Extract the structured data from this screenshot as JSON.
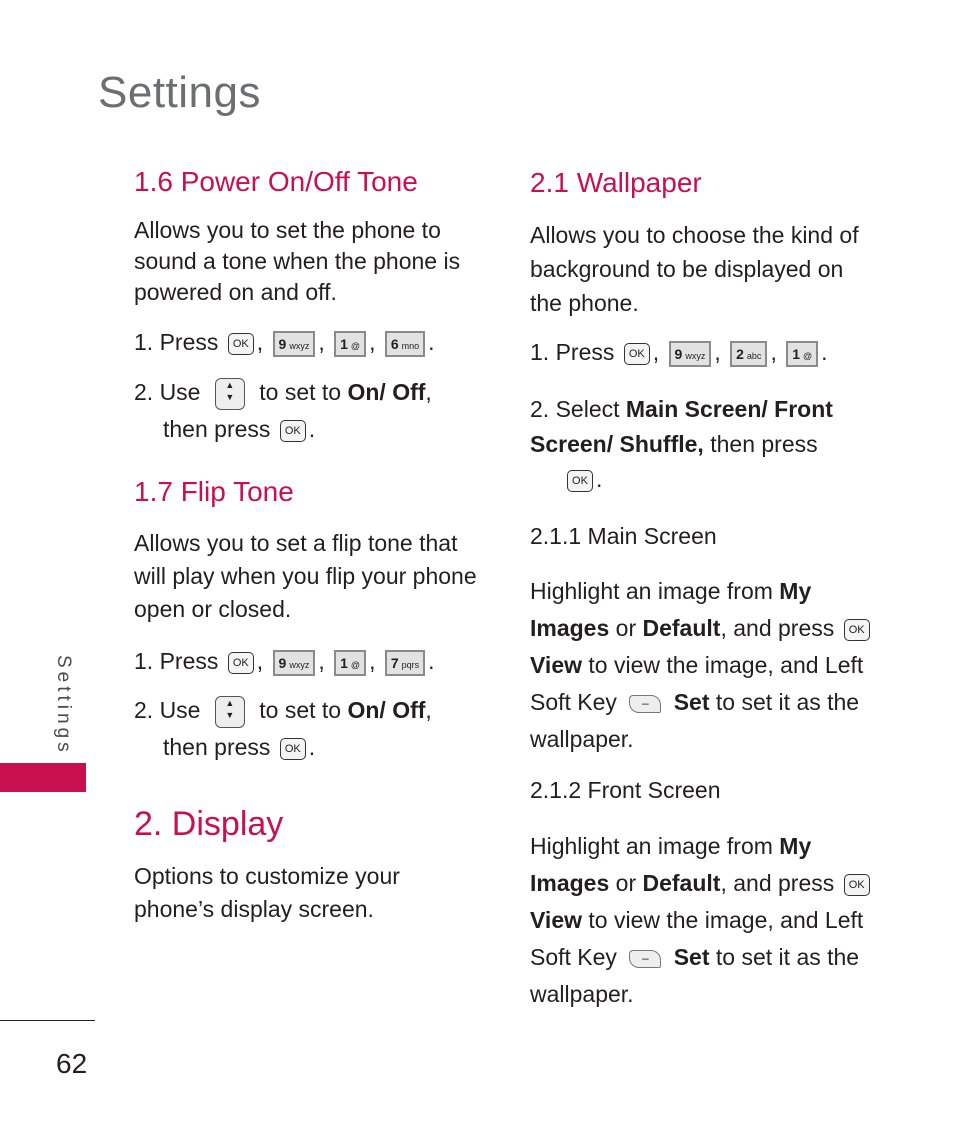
{
  "page_title": "Settings",
  "side_tab": "Settings",
  "page_number": "62",
  "accent_color": "#c8104e",
  "left": {
    "s16": {
      "heading": "1.6 Power On/Off Tone",
      "desc": "Allows you to set the phone to sound a tone when the phone is powered on and off.",
      "step1_prefix": "1. Press",
      "step1_keys": [
        {
          "num": "9",
          "letters": "wxyz"
        },
        {
          "num": "1",
          "letters": "@"
        },
        {
          "num": "6",
          "letters": "mno"
        }
      ],
      "step2_prefix": "2. Use",
      "step2_mid": "to set to",
      "step2_bold": "On/ Off",
      "step2_end": ",",
      "step2_cont": "then press"
    },
    "s17": {
      "heading": "1.7 Flip Tone",
      "desc": "Allows you to set a flip tone that will play when you flip your phone open or closed.",
      "step1_prefix": "1. Press",
      "step1_keys": [
        {
          "num": "9",
          "letters": "wxyz"
        },
        {
          "num": "1",
          "letters": "@"
        },
        {
          "num": "7",
          "letters": "pqrs"
        }
      ],
      "step2_prefix": "2. Use",
      "step2_mid": "to set to",
      "step2_bold": "On/ Off",
      "step2_end": ",",
      "step2_cont": "then press"
    },
    "s2": {
      "heading": "2. Display",
      "desc": "Options to customize your phone’s display screen."
    }
  },
  "right": {
    "s21": {
      "heading": "2.1 Wallpaper",
      "desc": "Allows you to choose the kind of background to be displayed on the phone.",
      "step1_prefix": "1. Press",
      "step1_keys": [
        {
          "num": "9",
          "letters": "wxyz"
        },
        {
          "num": "2",
          "letters": "abc"
        },
        {
          "num": "1",
          "letters": "@"
        }
      ],
      "step2_prefix": "2. Select",
      "step2_bold1": "Main Screen/ Front Screen/ Shuffle,",
      "step2_end": "then press"
    },
    "s211": {
      "heading": "2.1.1 Main Screen",
      "t1": "Highlight an image from",
      "b1": "My Images",
      "t2": "or",
      "b2": "Default",
      "t3": ", and press",
      "b3": "View",
      "t4": "to view the image, and Left Soft Key",
      "b4": "Set",
      "t5": "to set it as the wallpaper."
    },
    "s212": {
      "heading": "2.1.2 Front Screen",
      "t1": "Highlight an image from",
      "b1": "My Images",
      "t2": "or",
      "b2": "Default",
      "t3": ", and press",
      "b3": "View",
      "t4": "to view the image, and Left Soft Key",
      "b4": "Set",
      "t5": "to set it as the wallpaper."
    }
  },
  "icons": {
    "ok": "OK",
    "nav_up": "▲",
    "nav_down": "▼",
    "soft": "–"
  }
}
